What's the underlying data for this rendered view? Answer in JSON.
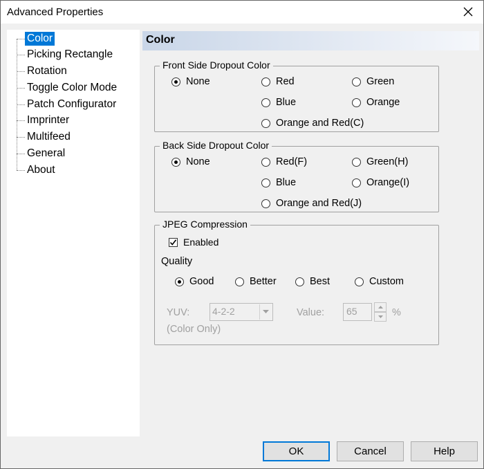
{
  "window": {
    "title": "Advanced Properties"
  },
  "tree": {
    "items": [
      {
        "label": "Color",
        "selected": true
      },
      {
        "label": "Picking Rectangle"
      },
      {
        "label": "Rotation"
      },
      {
        "label": "Toggle Color Mode"
      },
      {
        "label": "Patch Configurator"
      },
      {
        "label": "Imprinter"
      },
      {
        "label": "Multifeed"
      },
      {
        "label": "General"
      },
      {
        "label": "About"
      }
    ]
  },
  "section": {
    "title": "Color"
  },
  "front": {
    "title": "Front Side Dropout Color",
    "options": {
      "none": "None",
      "red": "Red",
      "green": "Green",
      "blue": "Blue",
      "orange": "Orange",
      "orange_red": "Orange and Red(C)"
    },
    "selected": "none"
  },
  "back": {
    "title": "Back Side Dropout Color",
    "options": {
      "none": "None",
      "red": "Red(F)",
      "green": "Green(H)",
      "blue": "Blue",
      "orange": "Orange(I)",
      "orange_red": "Orange and Red(J)"
    },
    "selected": "none"
  },
  "jpeg": {
    "title": "JPEG Compression",
    "enabled_label": "Enabled",
    "enabled": true,
    "quality_label": "Quality",
    "quality": {
      "good": "Good",
      "better": "Better",
      "best": "Best",
      "custom": "Custom"
    },
    "quality_selected": "good",
    "yuv_label": "YUV:",
    "yuv_value": "4-2-2",
    "color_only": "(Color Only)",
    "value_label": "Value:",
    "value": "65",
    "percent": "%"
  },
  "buttons": {
    "ok": "OK",
    "cancel": "Cancel",
    "help": "Help"
  }
}
